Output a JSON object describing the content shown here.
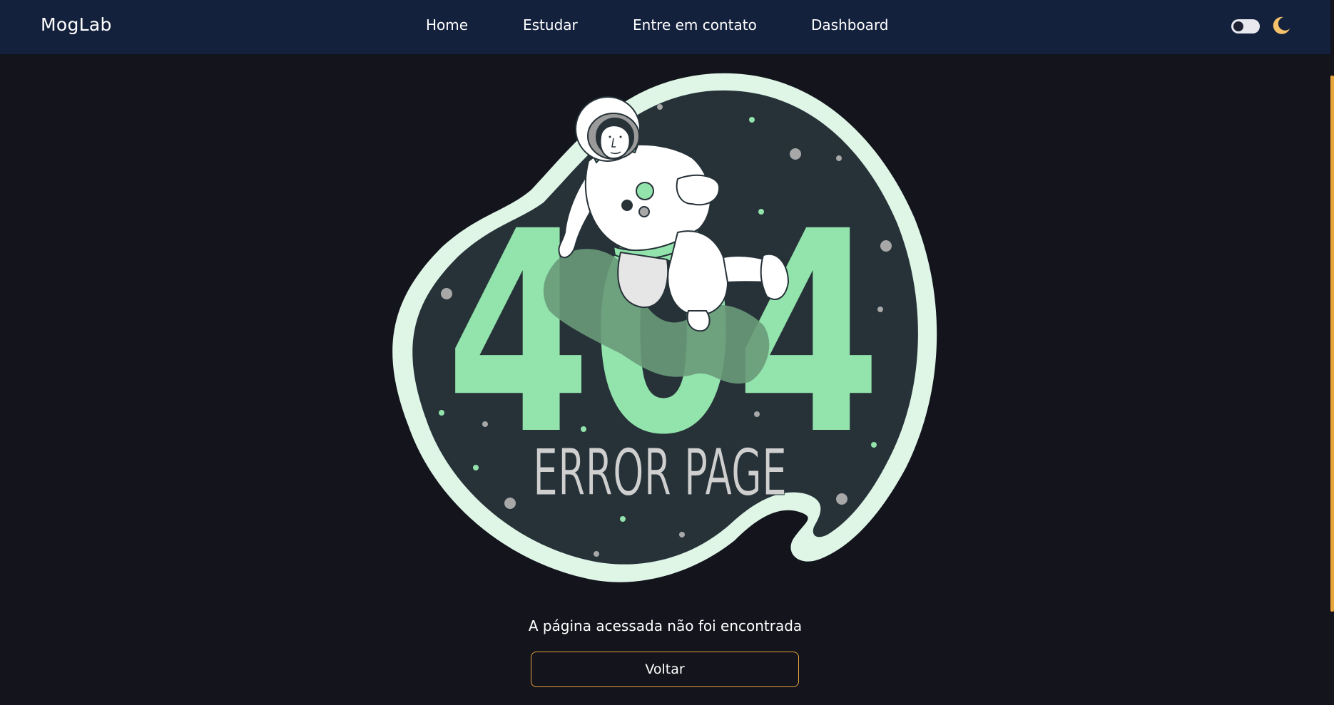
{
  "header": {
    "brand": "MogLab",
    "nav": [
      "Home",
      "Estudar",
      "Entre em contato",
      "Dashboard"
    ],
    "theme_toggle": "off",
    "theme_icon": "moon-icon"
  },
  "illustration": {
    "big_text": "404",
    "caption": "ERROR PAGE"
  },
  "main": {
    "message": "A página acessada não foi encontrada",
    "back_label": "Voltar"
  },
  "colors": {
    "navbar": "#14213d",
    "background": "#13141c",
    "accent": "#e8a33d",
    "green": "#93e3ac",
    "blob_outline": "#dff6e7",
    "blob_fill": "#263238"
  }
}
